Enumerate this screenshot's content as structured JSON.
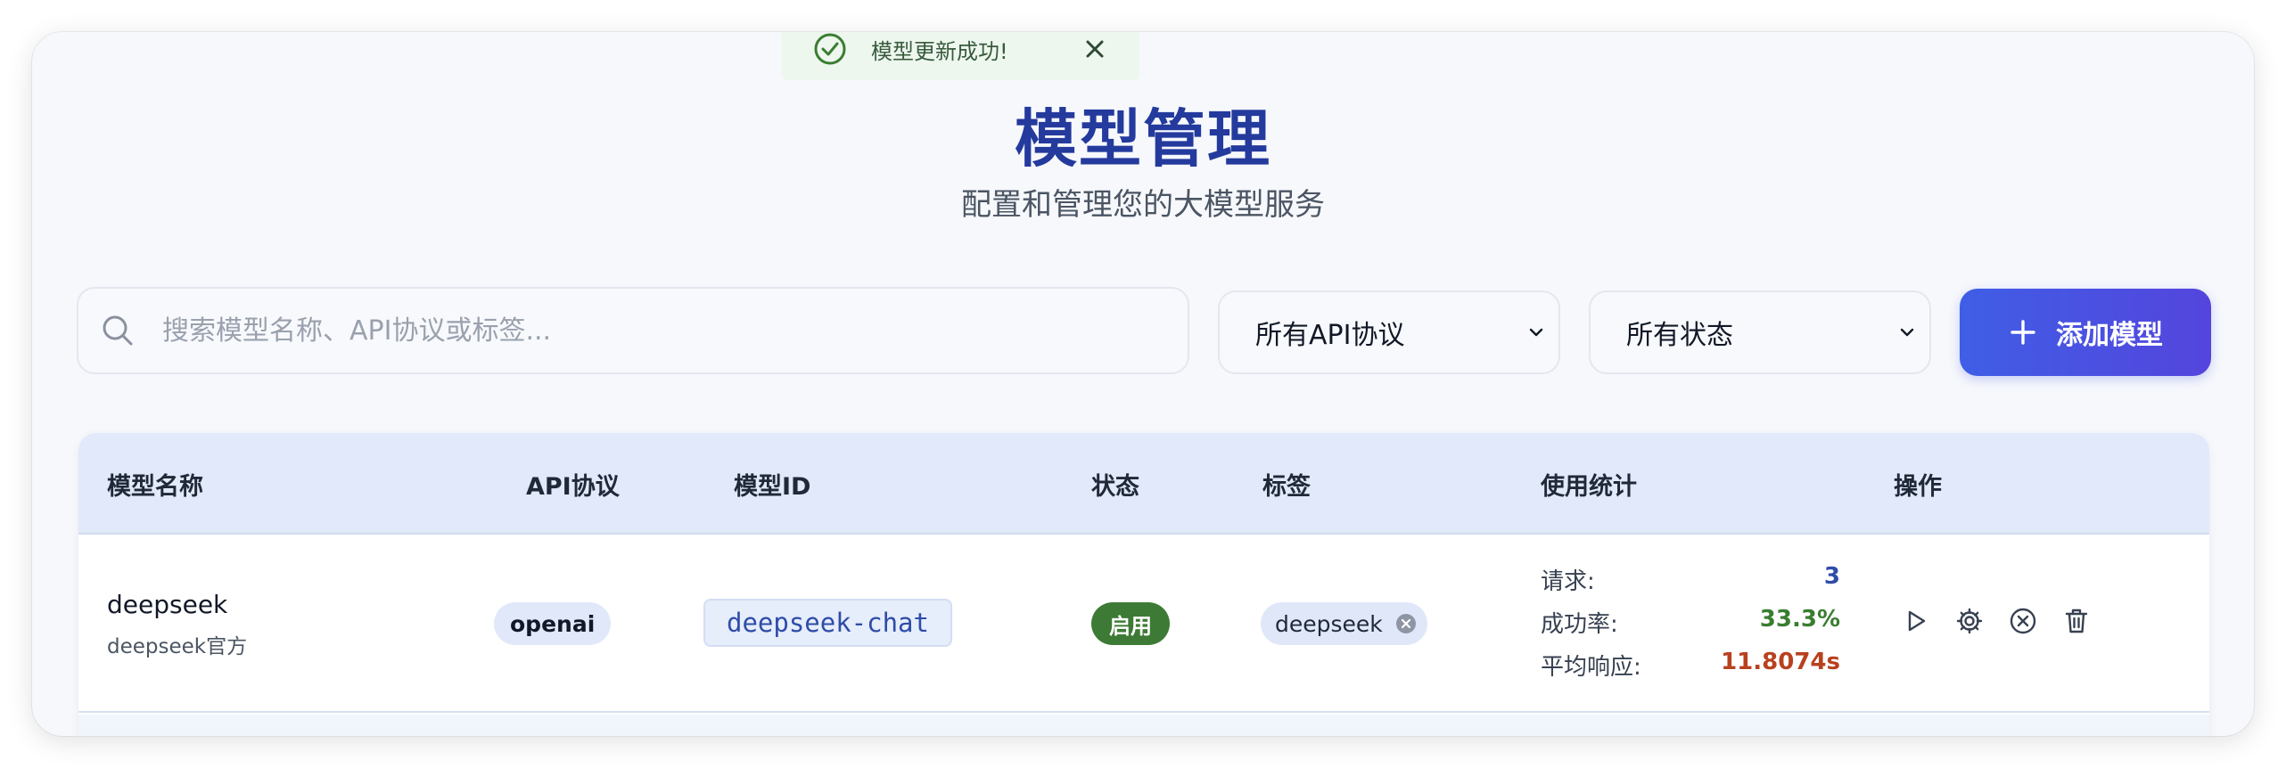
{
  "toast": {
    "message": "模型更新成功!"
  },
  "header": {
    "title": "模型管理",
    "subtitle": "配置和管理您的大模型服务"
  },
  "toolbar": {
    "search_placeholder": "搜索模型名称、API协议或标签...",
    "protocol_filter": "所有API协议",
    "status_filter": "所有状态",
    "add_label": "添加模型"
  },
  "table": {
    "columns": [
      "模型名称",
      "API协议",
      "模型ID",
      "状态",
      "标签",
      "使用统计",
      "操作"
    ],
    "rows": [
      {
        "name": "deepseek",
        "description": "deepseek官方",
        "protocol": "openai",
        "model_id": "deepseek-chat",
        "status": "启用",
        "tags": [
          "deepseek"
        ],
        "stats": {
          "requests_label": "请求:",
          "requests": "3",
          "success_label": "成功率:",
          "success_rate": "33.3%",
          "latency_label": "平均响应:",
          "avg_latency": "11.8074s"
        }
      }
    ]
  },
  "colors": {
    "accent": "#3f5ee6",
    "title": "#243a9d",
    "status_enabled": "#3d7a35",
    "requests": "#2e4ca8",
    "success": "#3a7d31",
    "latency": "#b8411e"
  }
}
